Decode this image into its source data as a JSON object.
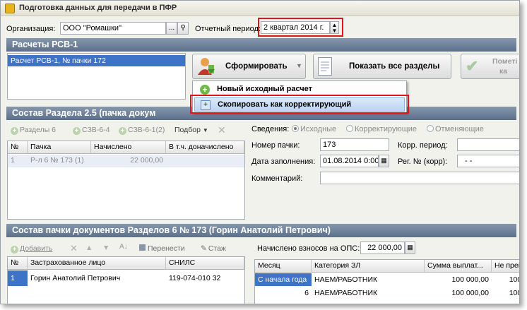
{
  "window": {
    "title": "Подготовка данных для передачи в ПФР"
  },
  "header": {
    "org_label": "Организация:",
    "org_value": "ООО \"Ромашки\"",
    "period_label": "Отчетный период:",
    "period_value": "2 квартал 2014 г."
  },
  "rsv": {
    "section_title": "Расчеты РСВ-1",
    "list_items": [
      "Расчет РСВ-1, № пачки 172"
    ],
    "form_button": "Сформировать",
    "show_all_button": "Показать все разделы",
    "mark_button_line1": "Пометі",
    "mark_button_line2": "ка"
  },
  "menu": {
    "items": [
      "Новый исходный расчет",
      "Скопировать как корректирующий"
    ]
  },
  "section25": {
    "title": "Состав Раздела 2.5    (пачка докум",
    "toolbar": [
      "Разделы 6",
      "СЗВ-6-4",
      "СЗВ-6-1(2)",
      "Подбор"
    ],
    "columns": [
      "№",
      "Пачка",
      "Начислено",
      "В т.ч. доначислено"
    ],
    "rows": [
      {
        "num": "1",
        "pack": "Р-л 6 № 173 (1)",
        "charged": "22 000,00",
        "extra": ""
      }
    ],
    "svedeniya_label": "Сведения:",
    "radios": [
      "Исходные",
      "Корректирующие",
      "Отменяющие"
    ],
    "pack_number_label": "Номер пачки:",
    "pack_number_value": "173",
    "corr_period_label": "Корр. период:",
    "fill_date_label": "Дата заполнения:",
    "fill_date_value": "01.08.2014 0:00",
    "reg_label": "Рег. № (корр):",
    "reg_value": "-  -",
    "comment_label": "Комментарий:"
  },
  "section6": {
    "title": "Состав пачки документов Разделов 6 № 173        (Горин Анатолий Петрович)",
    "toolbar": [
      "Добавить",
      "Перенести",
      "Стаж"
    ],
    "columns": [
      "№",
      "Застрахованное лицо",
      "СНИЛС"
    ],
    "rows": [
      {
        "num": "1",
        "person": "Горин Анатолий Петрович",
        "snils": "119-074-010 32"
      }
    ],
    "ops_label": "Начислено взносов на ОПС:",
    "ops_value": "22 000,00",
    "right_columns": [
      "Месяц",
      "Категория ЗЛ",
      "Сумма выплат...",
      "Не прев"
    ],
    "right_rows": [
      {
        "month": "С начала года",
        "cat": "НАЕМ/РАБОТНИК",
        "sum": "100 000,00",
        "np": "100 0"
      },
      {
        "month": "6",
        "cat": "НАЕМ/РАБОТНИК",
        "sum": "100 000,00",
        "np": "100 0"
      }
    ]
  },
  "colors": {
    "section_header": "#6b7e97",
    "highlight": "#e0141b",
    "selection": "#3f73c7"
  }
}
